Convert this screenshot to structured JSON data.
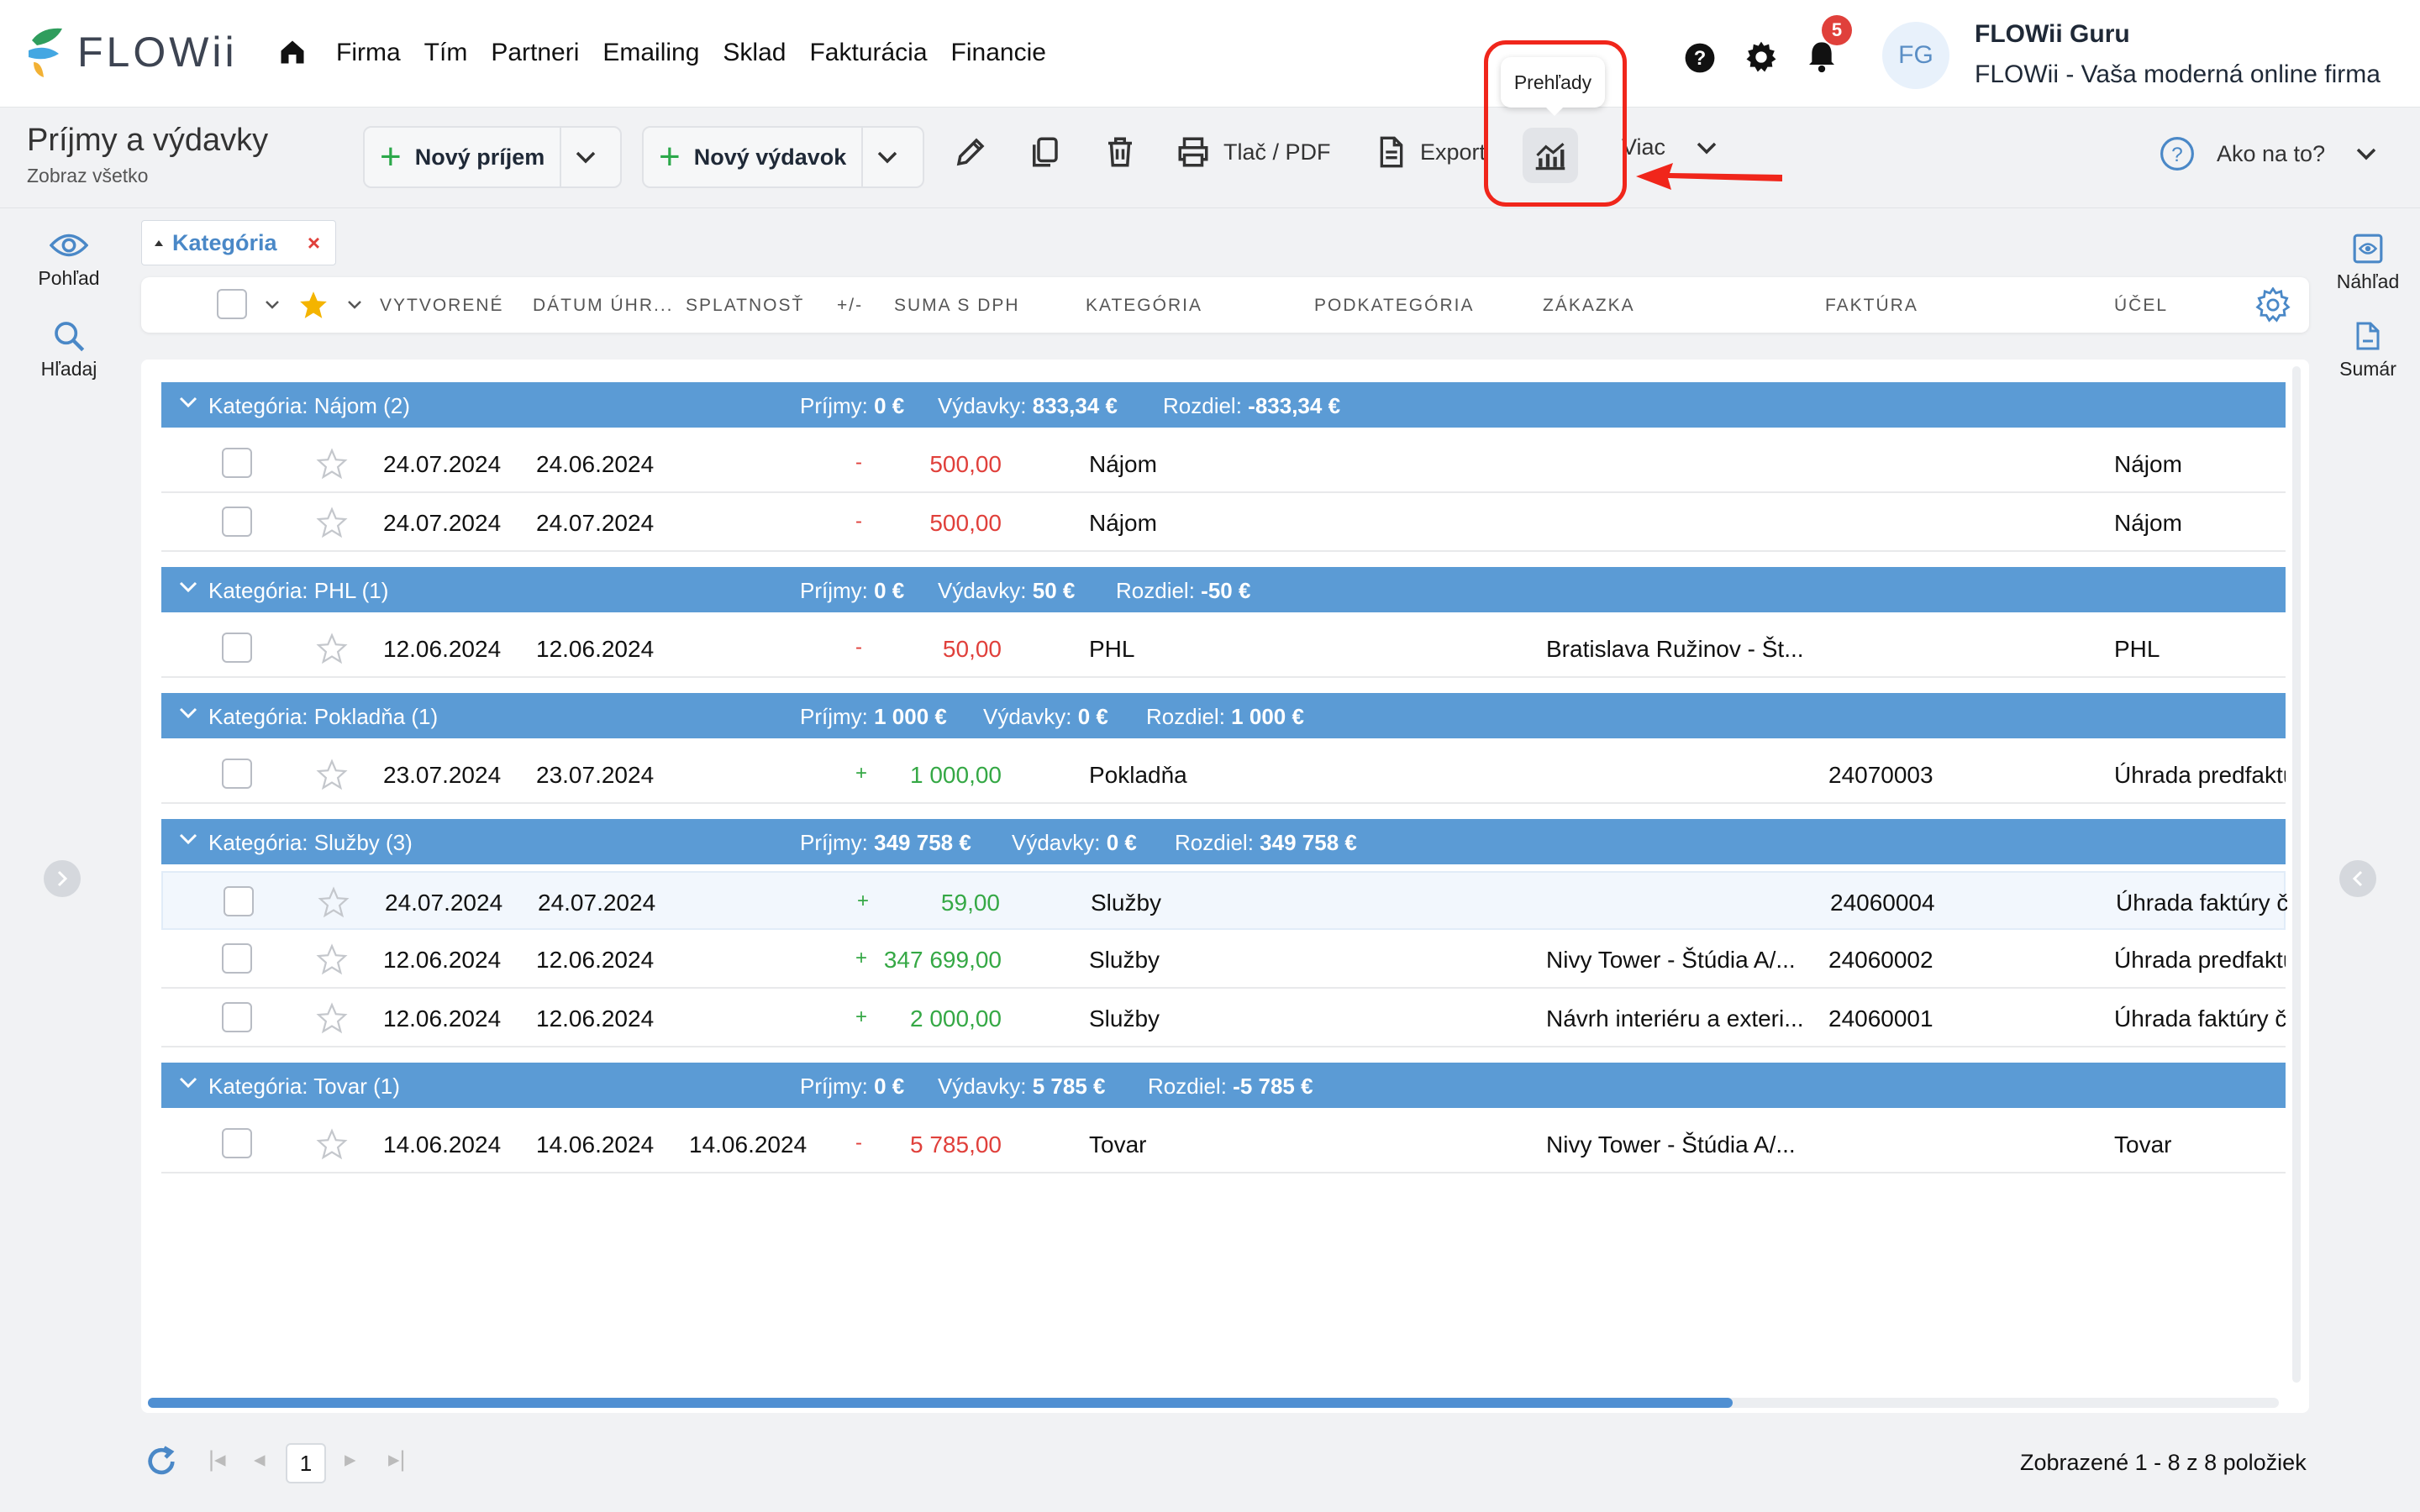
{
  "app": {
    "logo_text": "FLOWii"
  },
  "nav": [
    "Firma",
    "Tím",
    "Partneri",
    "Emailing",
    "Sklad",
    "Fakturácia",
    "Financie"
  ],
  "header": {
    "notifications": "5",
    "avatar": "FG",
    "user": "FLOWii Guru",
    "company": "FLOWii - Vaša moderná online firma"
  },
  "page": {
    "title": "Príjmy a výdavky",
    "subtitle": "Zobraz všetko"
  },
  "toolbar": {
    "new_income": "Nový príjem",
    "new_expense": "Nový výdavok",
    "print": "Tlač / PDF",
    "export": "Export",
    "more": "Viac",
    "tooltip": "Prehľady",
    "help": "Ako na to?"
  },
  "sidebar_left": [
    "Pohľad",
    "Hľadaj"
  ],
  "sidebar_right": [
    "Náhľad",
    "Sumár"
  ],
  "filter": {
    "label": "Kategória"
  },
  "columns": [
    "VYTVORENÉ",
    "DÁTUM ÚHR...",
    "SPLATNOSŤ",
    "+/-",
    "SUMA S DPH",
    "KATEGÓRIA",
    "PODKATEGÓRIA",
    "ZÁKAZKA",
    "FAKTÚRA",
    "ÚČEL"
  ],
  "groups": [
    {
      "label": "Kategória: Nájom (2)",
      "income_label": "Príjmy:",
      "income": "0 €",
      "expense_label": "Výdavky:",
      "expense": "833,34 €",
      "diff_label": "Rozdiel:",
      "diff": "-833,34 €",
      "rows": [
        {
          "created": "24.07.2024",
          "paid": "24.06.2024",
          "due": "",
          "sign": "-",
          "amount": "500,00",
          "category": "Nájom",
          "project": "",
          "invoice": "",
          "purpose": "Nájom"
        },
        {
          "created": "24.07.2024",
          "paid": "24.07.2024",
          "due": "",
          "sign": "-",
          "amount": "500,00",
          "category": "Nájom",
          "project": "",
          "invoice": "",
          "purpose": "Nájom"
        }
      ]
    },
    {
      "label": "Kategória: PHL (1)",
      "income_label": "Príjmy:",
      "income": "0 €",
      "expense_label": "Výdavky:",
      "expense": "50 €",
      "diff_label": "Rozdiel:",
      "diff": "-50 €",
      "rows": [
        {
          "created": "12.06.2024",
          "paid": "12.06.2024",
          "due": "",
          "sign": "-",
          "amount": "50,00",
          "category": "PHL",
          "project": "Bratislava Ružinov - Št...",
          "invoice": "",
          "purpose": "PHL"
        }
      ]
    },
    {
      "label": "Kategória: Pokladňa (1)",
      "income_label": "Príjmy:",
      "income": "1 000 €",
      "expense_label": "Výdavky:",
      "expense": "0 €",
      "diff_label": "Rozdiel:",
      "diff": "1 000 €",
      "rows": [
        {
          "created": "23.07.2024",
          "paid": "23.07.2024",
          "due": "",
          "sign": "+",
          "amount": "1 000,00",
          "category": "Pokladňa",
          "project": "",
          "invoice": "24070003",
          "purpose": "Úhrada predfaktú"
        }
      ]
    },
    {
      "label": "Kategória: Služby (3)",
      "income_label": "Príjmy:",
      "income": "349 758 €",
      "expense_label": "Výdavky:",
      "expense": "0 €",
      "diff_label": "Rozdiel:",
      "diff": "349 758 €",
      "rows": [
        {
          "created": "24.07.2024",
          "paid": "24.07.2024",
          "due": "",
          "sign": "+",
          "amount": "59,00",
          "category": "Služby",
          "project": "",
          "invoice": "24060004",
          "purpose": "Úhrada faktúry č"
        },
        {
          "created": "12.06.2024",
          "paid": "12.06.2024",
          "due": "",
          "sign": "+",
          "amount": "347 699,00",
          "category": "Služby",
          "project": "Nivy Tower - Štúdia A/...",
          "invoice": "24060002",
          "purpose": "Úhrada predfaktú"
        },
        {
          "created": "12.06.2024",
          "paid": "12.06.2024",
          "due": "",
          "sign": "+",
          "amount": "2 000,00",
          "category": "Služby",
          "project": "Návrh interiéru a exteri...",
          "invoice": "24060001",
          "purpose": "Úhrada faktúry č"
        }
      ]
    },
    {
      "label": "Kategória: Tovar (1)",
      "income_label": "Príjmy:",
      "income": "0 €",
      "expense_label": "Výdavky:",
      "expense": "5 785 €",
      "diff_label": "Rozdiel:",
      "diff": "-5 785 €",
      "rows": [
        {
          "created": "14.06.2024",
          "paid": "14.06.2024",
          "due": "14.06.2024",
          "sign": "-",
          "amount": "5 785,00",
          "category": "Tovar",
          "project": "Nivy Tower - Štúdia A/...",
          "invoice": "",
          "purpose": "Tovar"
        }
      ]
    }
  ],
  "pagination": {
    "page": "1",
    "info": "Zobrazené 1 - 8 z 8 položiek"
  },
  "colors": {
    "accent": "#5b9bd5",
    "expense": "#e0403b",
    "income": "#35a845",
    "highlight": "#f0261b"
  }
}
